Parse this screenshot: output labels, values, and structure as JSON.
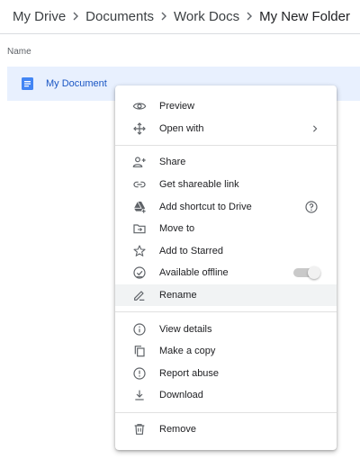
{
  "breadcrumb": {
    "items": [
      "My Drive",
      "Documents",
      "Work Docs",
      "My New Folder"
    ]
  },
  "file_list": {
    "column_header": "Name",
    "files": [
      {
        "name": "My Document",
        "icon": "google-docs-icon",
        "selected": true
      }
    ]
  },
  "context_menu": {
    "preview": {
      "label": "Preview",
      "icon": "eye-icon"
    },
    "open_with": {
      "label": "Open with",
      "icon": "move-arrows-icon",
      "submenu": true
    },
    "share": {
      "label": "Share",
      "icon": "person-add-icon"
    },
    "get_link": {
      "label": "Get shareable link",
      "icon": "link-icon"
    },
    "add_shortcut": {
      "label": "Add shortcut to Drive",
      "icon": "drive-shortcut-icon",
      "help": true
    },
    "move_to": {
      "label": "Move to",
      "icon": "folder-move-icon"
    },
    "add_starred": {
      "label": "Add to Starred",
      "icon": "star-outline-icon"
    },
    "available_offline": {
      "label": "Available offline",
      "icon": "offline-check-icon",
      "toggle_on": false
    },
    "rename": {
      "label": "Rename",
      "icon": "pencil-icon",
      "highlighted": true
    },
    "view_details": {
      "label": "View details",
      "icon": "info-icon"
    },
    "make_copy": {
      "label": "Make a copy",
      "icon": "copy-icon"
    },
    "report_abuse": {
      "label": "Report abuse",
      "icon": "report-icon"
    },
    "download": {
      "label": "Download",
      "icon": "download-icon"
    },
    "remove": {
      "label": "Remove",
      "icon": "trash-icon"
    }
  },
  "colors": {
    "selection": "#e8f0fe",
    "doc_blue": "#4285f4",
    "link_blue": "#1a56c4",
    "menu_highlight": "#f1f3f4",
    "icon_gray": "#5f6368"
  }
}
